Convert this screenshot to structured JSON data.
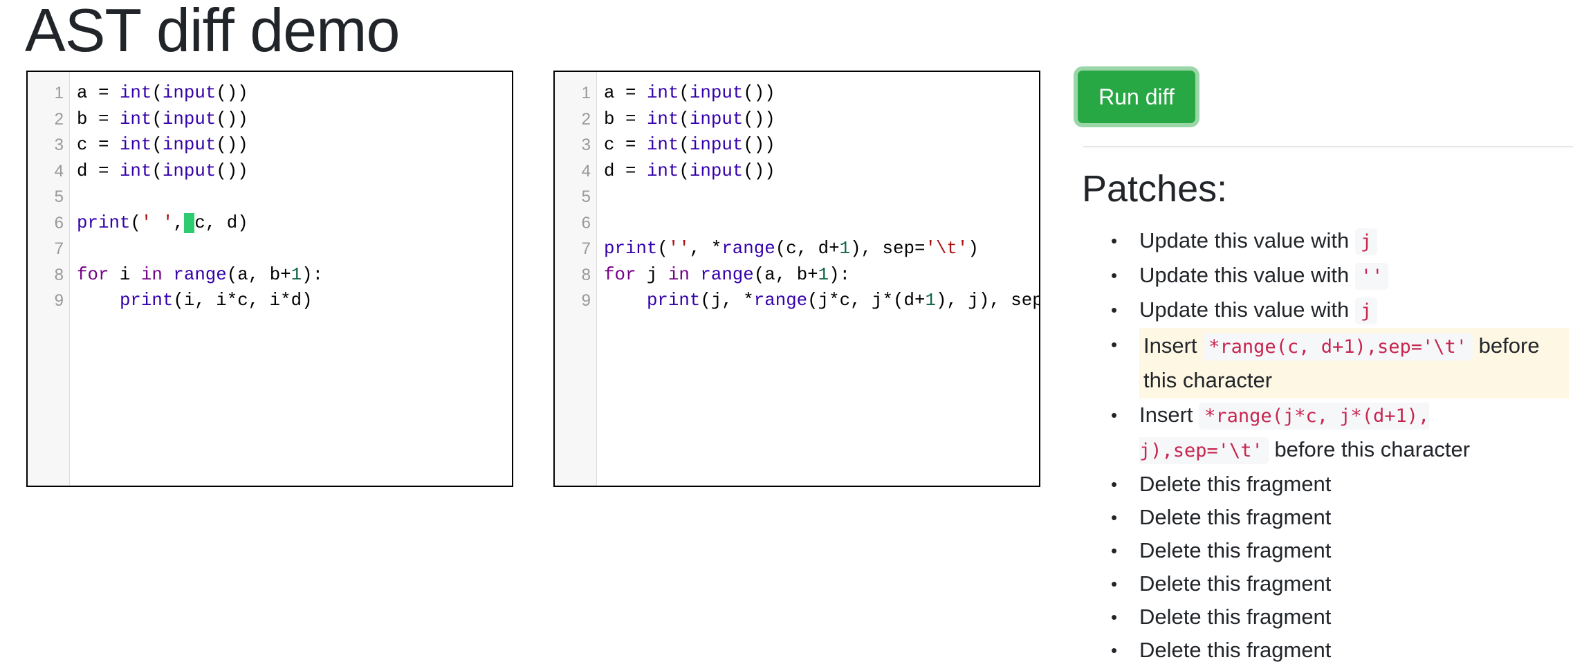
{
  "page": {
    "title": "AST diff demo"
  },
  "editors": {
    "left": {
      "lines": [
        {
          "n": "1",
          "tokens": [
            {
              "t": "a = ",
              "c": "plain"
            },
            {
              "t": "int",
              "c": "builtin"
            },
            {
              "t": "(",
              "c": "plain"
            },
            {
              "t": "input",
              "c": "builtin"
            },
            {
              "t": "())",
              "c": "plain"
            }
          ]
        },
        {
          "n": "2",
          "tokens": [
            {
              "t": "b = ",
              "c": "plain"
            },
            {
              "t": "int",
              "c": "builtin"
            },
            {
              "t": "(",
              "c": "plain"
            },
            {
              "t": "input",
              "c": "builtin"
            },
            {
              "t": "())",
              "c": "plain"
            }
          ]
        },
        {
          "n": "3",
          "tokens": [
            {
              "t": "c = ",
              "c": "plain"
            },
            {
              "t": "int",
              "c": "builtin"
            },
            {
              "t": "(",
              "c": "plain"
            },
            {
              "t": "input",
              "c": "builtin"
            },
            {
              "t": "())",
              "c": "plain"
            }
          ]
        },
        {
          "n": "4",
          "tokens": [
            {
              "t": "d = ",
              "c": "plain"
            },
            {
              "t": "int",
              "c": "builtin"
            },
            {
              "t": "(",
              "c": "plain"
            },
            {
              "t": "input",
              "c": "builtin"
            },
            {
              "t": "())",
              "c": "plain"
            }
          ]
        },
        {
          "n": "5",
          "tokens": []
        },
        {
          "n": "6",
          "tokens": [
            {
              "t": "print",
              "c": "builtin"
            },
            {
              "t": "(",
              "c": "plain"
            },
            {
              "t": "' '",
              "c": "string"
            },
            {
              "t": ",",
              "c": "plain"
            },
            {
              "t": " ",
              "c": "mark"
            },
            {
              "t": "c, d)",
              "c": "plain"
            }
          ]
        },
        {
          "n": "7",
          "tokens": []
        },
        {
          "n": "8",
          "tokens": [
            {
              "t": "for",
              "c": "keyword"
            },
            {
              "t": " i ",
              "c": "plain"
            },
            {
              "t": "in",
              "c": "keyword"
            },
            {
              "t": " ",
              "c": "plain"
            },
            {
              "t": "range",
              "c": "builtin"
            },
            {
              "t": "(a, b+",
              "c": "plain"
            },
            {
              "t": "1",
              "c": "number"
            },
            {
              "t": "):",
              "c": "plain"
            }
          ]
        },
        {
          "n": "9",
          "tokens": [
            {
              "t": "    ",
              "c": "plain"
            },
            {
              "t": "print",
              "c": "builtin"
            },
            {
              "t": "(i, i*c, i*d)",
              "c": "plain"
            }
          ]
        }
      ]
    },
    "right": {
      "lines": [
        {
          "n": "1",
          "tokens": [
            {
              "t": "a = ",
              "c": "plain"
            },
            {
              "t": "int",
              "c": "builtin"
            },
            {
              "t": "(",
              "c": "plain"
            },
            {
              "t": "input",
              "c": "builtin"
            },
            {
              "t": "())",
              "c": "plain"
            }
          ]
        },
        {
          "n": "2",
          "tokens": [
            {
              "t": "b = ",
              "c": "plain"
            },
            {
              "t": "int",
              "c": "builtin"
            },
            {
              "t": "(",
              "c": "plain"
            },
            {
              "t": "input",
              "c": "builtin"
            },
            {
              "t": "())",
              "c": "plain"
            }
          ]
        },
        {
          "n": "3",
          "tokens": [
            {
              "t": "c = ",
              "c": "plain"
            },
            {
              "t": "int",
              "c": "builtin"
            },
            {
              "t": "(",
              "c": "plain"
            },
            {
              "t": "input",
              "c": "builtin"
            },
            {
              "t": "())",
              "c": "plain"
            }
          ]
        },
        {
          "n": "4",
          "tokens": [
            {
              "t": "d = ",
              "c": "plain"
            },
            {
              "t": "int",
              "c": "builtin"
            },
            {
              "t": "(",
              "c": "plain"
            },
            {
              "t": "input",
              "c": "builtin"
            },
            {
              "t": "())",
              "c": "plain"
            }
          ]
        },
        {
          "n": "5",
          "tokens": []
        },
        {
          "n": "6",
          "tokens": []
        },
        {
          "n": "7",
          "tokens": [
            {
              "t": "print",
              "c": "builtin"
            },
            {
              "t": "(",
              "c": "plain"
            },
            {
              "t": "''",
              "c": "string"
            },
            {
              "t": ", *",
              "c": "plain"
            },
            {
              "t": "range",
              "c": "builtin"
            },
            {
              "t": "(c, d+",
              "c": "plain"
            },
            {
              "t": "1",
              "c": "number"
            },
            {
              "t": "), sep=",
              "c": "plain"
            },
            {
              "t": "'\\t'",
              "c": "string"
            },
            {
              "t": ")",
              "c": "plain"
            }
          ]
        },
        {
          "n": "8",
          "tokens": [
            {
              "t": "for",
              "c": "keyword"
            },
            {
              "t": " j ",
              "c": "plain"
            },
            {
              "t": "in",
              "c": "keyword"
            },
            {
              "t": " ",
              "c": "plain"
            },
            {
              "t": "range",
              "c": "builtin"
            },
            {
              "t": "(a, b+",
              "c": "plain"
            },
            {
              "t": "1",
              "c": "number"
            },
            {
              "t": "):",
              "c": "plain"
            }
          ]
        },
        {
          "n": "9",
          "tokens": [
            {
              "t": "    ",
              "c": "plain"
            },
            {
              "t": "print",
              "c": "builtin"
            },
            {
              "t": "(j, *",
              "c": "plain"
            },
            {
              "t": "range",
              "c": "builtin"
            },
            {
              "t": "(j*c, j*(d+",
              "c": "plain"
            },
            {
              "t": "1",
              "c": "number"
            },
            {
              "t": "), j), sep",
              "c": "plain"
            }
          ]
        }
      ]
    }
  },
  "toolbar": {
    "run_label": "Run diff"
  },
  "patches": {
    "title": "Patches:",
    "items": [
      {
        "text": "Update this value with",
        "code": "j",
        "after": "",
        "highlight": false,
        "narrow": false
      },
      {
        "text": "Update this value with",
        "code": "''",
        "after": "",
        "highlight": false,
        "narrow": false
      },
      {
        "text": "Update this value with",
        "code": "j",
        "after": "",
        "highlight": false,
        "narrow": false
      },
      {
        "text": "Insert",
        "code": "*range(c, d+1),sep='\\t'",
        "after": "before this character",
        "highlight": true,
        "narrow": false
      },
      {
        "text": "Insert",
        "code": "*range(j*c, j*(d+1), j),sep='\\t'",
        "after": "before this character",
        "highlight": false,
        "narrow": true
      },
      {
        "text": "Delete this fragment",
        "code": "",
        "after": "",
        "highlight": false,
        "narrow": false
      },
      {
        "text": "Delete this fragment",
        "code": "",
        "after": "",
        "highlight": false,
        "narrow": false
      },
      {
        "text": "Delete this fragment",
        "code": "",
        "after": "",
        "highlight": false,
        "narrow": false
      },
      {
        "text": "Delete this fragment",
        "code": "",
        "after": "",
        "highlight": false,
        "narrow": false
      },
      {
        "text": "Delete this fragment",
        "code": "",
        "after": "",
        "highlight": false,
        "narrow": false
      },
      {
        "text": "Delete this fragment",
        "code": "",
        "after": "",
        "highlight": false,
        "narrow": false
      }
    ]
  },
  "colors": {
    "button": "#28a745",
    "diff_mark": "#2ecc71",
    "highlight_bg": "#fdf7e4",
    "code_text": "#c7254e"
  }
}
